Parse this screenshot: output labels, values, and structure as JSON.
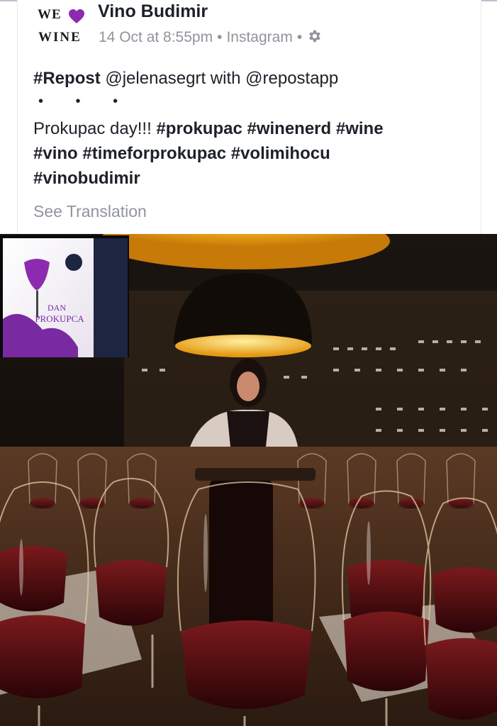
{
  "header": {
    "avatar_text_top": "WE",
    "avatar_text_bottom": "WINE",
    "page_name": "Vino Budimir",
    "timestamp": "14 Oct at 8:55pm",
    "source": "Instagram",
    "separator": "•"
  },
  "post": {
    "line1_tag": "#Repost",
    "line1_rest": " @jelenasegrt with @repostapp",
    "dots": "• • •",
    "line2_text": "Prokupac day!!! ",
    "line2_tags": "#prokupac #winenerd #wine",
    "line3_tags": "#vino #timeforprokupac #volimihocu",
    "line4_tags": "#vinobudimir",
    "see_translation": "See Translation"
  },
  "photo": {
    "screen_line1": "DAN",
    "screen_line2": "PROKUPCA",
    "colors": {
      "lamp": "#f2b21c",
      "wine": "#5a0b0e",
      "screen_purple": "#8d2bb0"
    }
  },
  "icons": [
    "heart-icon",
    "gear-icon"
  ]
}
